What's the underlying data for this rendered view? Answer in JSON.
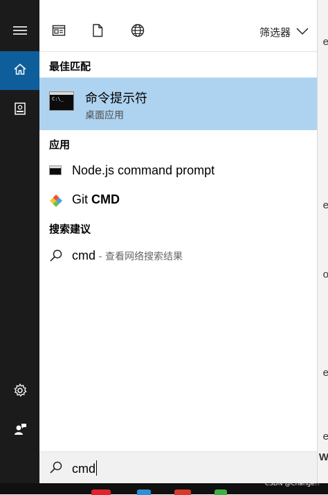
{
  "search_panel": {
    "filter_label": "筛选器",
    "best_match": {
      "heading": "最佳匹配",
      "title": "命令提示符",
      "subtitle": "桌面应用"
    },
    "apps": {
      "heading": "应用",
      "items": [
        {
          "label": "Node.js command prompt",
          "icon": "node-console-icon"
        },
        {
          "label_prefix": "Git ",
          "label_bold": "CMD",
          "icon": "git-icon"
        }
      ]
    },
    "suggestions": {
      "heading": "搜索建议",
      "items": [
        {
          "query": "cmd",
          "hint": " - 查看网络搜索结果",
          "icon": "search-icon"
        }
      ]
    },
    "search_box": {
      "value": "cmd",
      "icon": "search-icon"
    }
  },
  "left_rail": {
    "items": [
      {
        "icon": "hamburger-menu-icon",
        "active": false
      },
      {
        "icon": "home-icon",
        "active": true
      },
      {
        "icon": "document-icon",
        "active": false
      },
      {
        "icon": "settings-gear-icon",
        "active": false
      },
      {
        "icon": "feedback-person-icon",
        "active": false
      }
    ]
  },
  "background_window": {
    "fragments": [
      "e",
      "e",
      "o",
      "e",
      "e",
      "W"
    ]
  },
  "watermark": "CSDN @Change!!",
  "colors": {
    "rail_bg": "#1b1b1b",
    "rail_active": "#0f5e9c",
    "best_match_bg": "#aed3f0",
    "search_box_bg": "#f1f1f1"
  }
}
